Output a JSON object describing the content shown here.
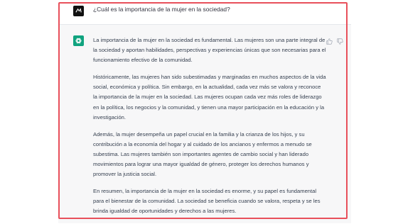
{
  "colors": {
    "highlight_border": "#e8505b",
    "bot_avatar": "#10a37f",
    "user_avatar": "#111111",
    "bot_row_bg": "#f7f7f8"
  },
  "user_message": {
    "text": "¿Cuál es la importancia de la mujer en la sociedad?",
    "avatar_icon": "user-avatar-icon"
  },
  "assistant_message": {
    "avatar_icon": "openai-logo-icon",
    "paragraphs": [
      "La importancia de la mujer en la sociedad es fundamental. Las mujeres son una parte integral de la sociedad y aportan habilidades, perspectivas y experiencias únicas que son necesarias para el funcionamiento efectivo de la comunidad.",
      "Históricamente, las mujeres han sido subestimadas y marginadas en muchos aspectos de la vida social, económica y política. Sin embargo, en la actualidad, cada vez más se valora y reconoce la importancia de la mujer en la sociedad. Las mujeres ocupan cada vez más roles de liderazgo en la política, los negocios y la comunidad, y tienen una mayor participación en la educación y la investigación.",
      "Además, la mujer desempeña un papel crucial en la familia y la crianza de los hijos, y su contribución a la economía del hogar y al cuidado de los ancianos y enfermos a menudo se subestima. Las mujeres también son importantes agentes de cambio social y han liderado movimientos para lograr una mayor igualdad de género, proteger los derechos humanos y promover la justicia social.",
      "En resumen, la importancia de la mujer en la sociedad es enorme, y su papel es fundamental para el bienestar de la comunidad. La sociedad se beneficia cuando se valora, respeta y se les brinda igualdad de oportunidades y derechos a las mujeres."
    ],
    "feedback_icons": [
      "thumbs-up-icon",
      "thumbs-down-icon"
    ]
  }
}
